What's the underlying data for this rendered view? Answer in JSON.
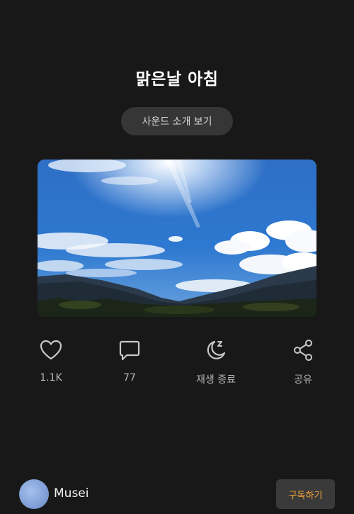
{
  "header": {
    "title": "맑은날 아침",
    "intro_button_label": "사운드 소개 보기"
  },
  "actions": [
    {
      "icon": "heart-icon",
      "label": "1.1K"
    },
    {
      "icon": "comment-icon",
      "label": "77"
    },
    {
      "icon": "moon-sleep-icon",
      "label": "재생 종료"
    },
    {
      "icon": "share-icon",
      "label": "공유"
    }
  ],
  "footer": {
    "creator_name": "Musei",
    "subscribe_label": "구독하기"
  },
  "colors": {
    "background": "#181818",
    "accent": "#f3a23a",
    "icon": "#c8c8c8"
  }
}
